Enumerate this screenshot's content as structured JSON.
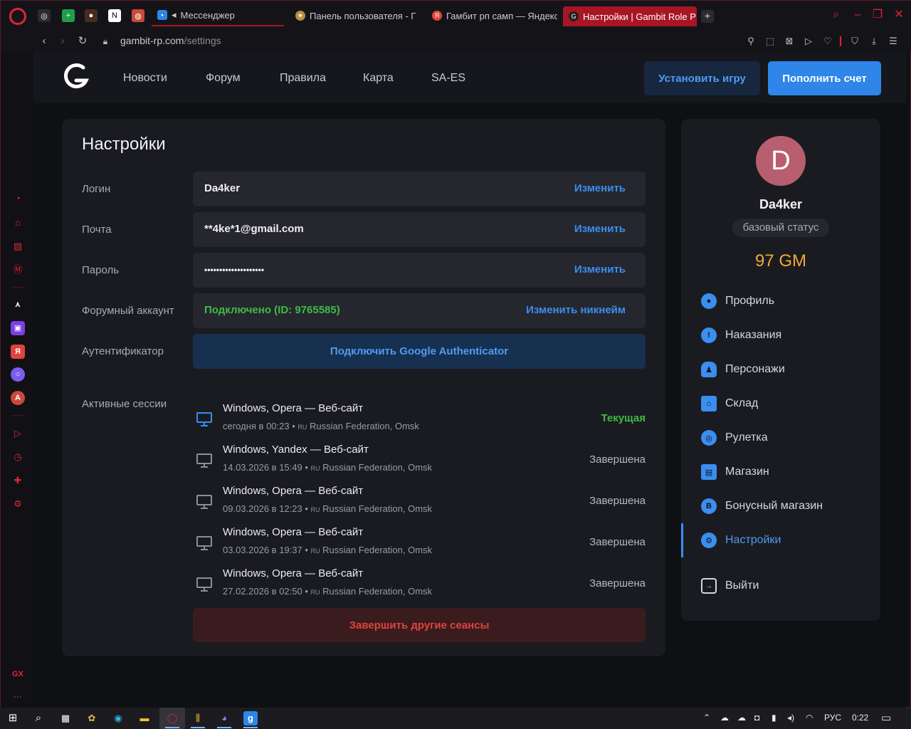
{
  "browser": {
    "tabs": [
      {
        "title": "Мессенджер",
        "fav_color": "#2d86e8"
      },
      {
        "title": "Панель пользователя - Г",
        "fav_color": "#b59040"
      },
      {
        "title": "Гамбит рп самп — Яндекс",
        "fav_color": "#e0433c"
      },
      {
        "title": "Настройки | Gambit Role P",
        "fav_color": "#222222"
      }
    ],
    "url_host": "gambit-rp.com",
    "url_path": "/settings",
    "sidebar_app_labels": {
      "gx": "GX"
    }
  },
  "site": {
    "nav": [
      "Новости",
      "Форум",
      "Правила",
      "Карта",
      "SA-ES"
    ],
    "install_label": "Установить игру",
    "topup_label": "Пополнить счет"
  },
  "settings": {
    "title": "Настройки",
    "fields": [
      {
        "label": "Логин",
        "value": "Da4ker",
        "action": "Изменить"
      },
      {
        "label": "Почта",
        "value": "**4ke*1@gmail.com",
        "action": "Изменить"
      },
      {
        "label": "Пароль",
        "value": "••••••••••••••••••••",
        "action": "Изменить"
      },
      {
        "label": "Форумный аккаунт",
        "value": "Подключено (ID: 9765585)",
        "action": "Изменить никнейм"
      }
    ],
    "auth_label": "Аутентификатор",
    "auth_button": "Подключить Google Authenticator",
    "sessions_label": "Активные сессии",
    "sessions": [
      {
        "title": "Windows, Opera — Веб-сайт",
        "date": "сегодня в 00:23",
        "country_code": "RU",
        "location": "Russian Federation, Omsk",
        "status": "Текущая"
      },
      {
        "title": "Windows, Yandex — Веб-сайт",
        "date": "14.03.2026 в 15:49",
        "country_code": "RU",
        "location": "Russian Federation, Omsk",
        "status": "Завершена"
      },
      {
        "title": "Windows, Opera — Веб-сайт",
        "date": "09.03.2026 в 12:23",
        "country_code": "RU",
        "location": "Russian Federation, Omsk",
        "status": "Завершена"
      },
      {
        "title": "Windows, Opera — Веб-сайт",
        "date": "03.03.2026 в 19:37",
        "country_code": "RU",
        "location": "Russian Federation, Omsk",
        "status": "Завершена"
      },
      {
        "title": "Windows, Opera — Веб-сайт",
        "date": "27.02.2026 в 02:50",
        "country_code": "RU",
        "location": "Russian Federation, Omsk",
        "status": "Завершена"
      }
    ],
    "end_sessions_button": "Завершить другие сеансы"
  },
  "profile": {
    "initial": "D",
    "name": "Da4ker",
    "status": "базовый статус",
    "balance": "97 GM",
    "menu": [
      {
        "label": "Профиль",
        "icon": "user-icon"
      },
      {
        "label": "Наказания",
        "icon": "warning-icon"
      },
      {
        "label": "Персонажи",
        "icon": "person-icon"
      },
      {
        "label": "Склад",
        "icon": "warehouse-icon"
      },
      {
        "label": "Рулетка",
        "icon": "roulette-icon"
      },
      {
        "label": "Магазин",
        "icon": "shop-icon"
      },
      {
        "label": "Бонусный магазин",
        "icon": "bonus-shop-icon"
      },
      {
        "label": "Настройки",
        "icon": "gear-icon"
      },
      {
        "label": "Выйти",
        "icon": "logout-icon"
      }
    ],
    "active_item": "Настройки"
  },
  "taskbar": {
    "lang": "РУС",
    "time": "0:22"
  },
  "colors": {
    "accent": "#3a8ef0",
    "success": "#3dbb47",
    "danger": "#e0433c",
    "gold": "#f0a93a",
    "opera_red": "#e0233a"
  }
}
